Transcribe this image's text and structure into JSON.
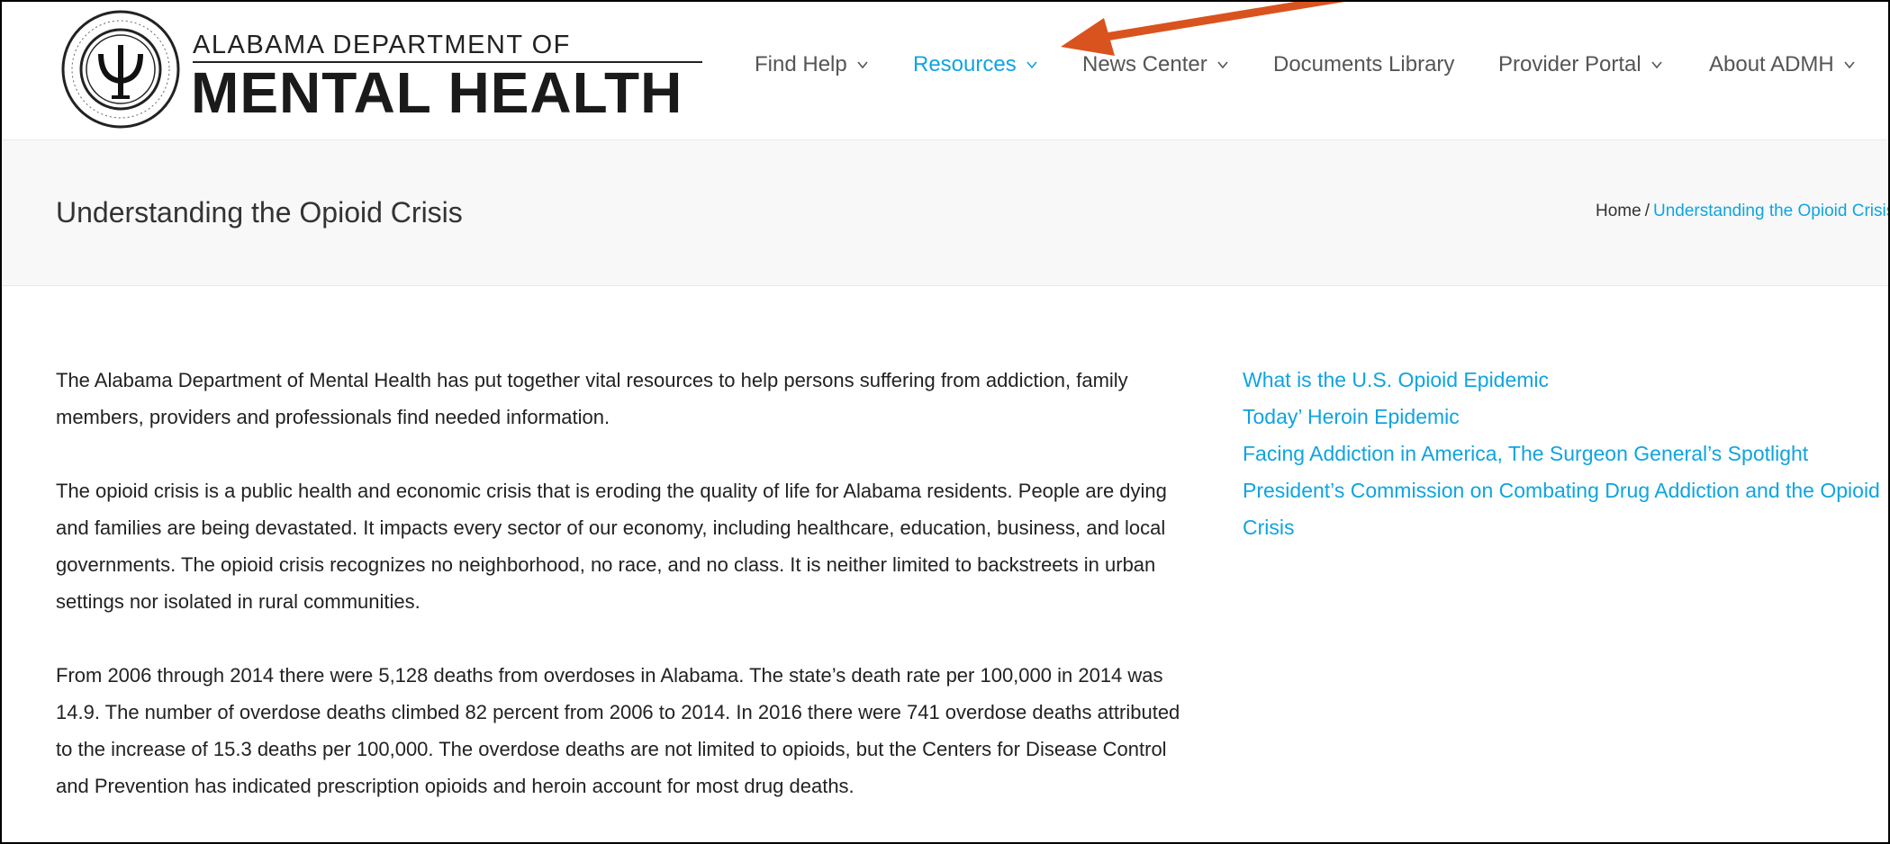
{
  "logo": {
    "line1": "ALABAMA DEPARTMENT OF",
    "line2": "MENTAL HEALTH",
    "seal_top": "ALABAMA",
    "seal_bottom": "DEPARTMENT OF MENTAL HEALTH"
  },
  "nav": {
    "items": [
      {
        "label": "Find Help",
        "dropdown": true
      },
      {
        "label": "Resources",
        "dropdown": true,
        "active": true
      },
      {
        "label": "News Center",
        "dropdown": true
      },
      {
        "label": "Documents Library",
        "dropdown": false
      },
      {
        "label": "Provider Portal",
        "dropdown": true
      },
      {
        "label": "About ADMH",
        "dropdown": true
      }
    ]
  },
  "page": {
    "title": "Understanding the Opioid Crisis",
    "breadcrumb_home": "Home",
    "breadcrumb_sep": "/",
    "breadcrumb_current": "Understanding the Opioid Crisis"
  },
  "content": {
    "paragraphs": [
      "The Alabama Department of Mental Health has put together vital resources to help persons suffering from addiction, family members, providers and professionals find needed information.",
      "The opioid crisis is a public health and economic crisis that is eroding the quality of life for Alabama residents. People are dying and families are being devastated. It impacts every sector of our economy, including healthcare, education, business, and local governments. The opioid crisis recognizes no neighborhood, no race, and no class. It is neither limited to backstreets in urban settings nor isolated in rural communities.",
      "From 2006 through 2014 there were 5,128 deaths from overdoses in Alabama. The state’s death rate per 100,000 in 2014 was 14.9. The number of overdose deaths climbed 82 percent from 2006 to 2014. In 2016 there were 741 overdose deaths attributed to the increase of 15.3 deaths per 100,000. The overdose deaths are not limited to opioids, but the Centers for Disease Control and Prevention has indicated prescription opioids and heroin account for most drug deaths."
    ]
  },
  "sidebar": {
    "links": [
      "What is the U.S. Opioid Epidemic",
      "Today’ Heroin Epidemic",
      "Facing Addiction in America, The Surgeon General’s Spotlight",
      "President’s Commission on Combating Drug Addiction and the Opioid Crisis"
    ]
  },
  "colors": {
    "accent": "#0fa4e0",
    "annotation_arrow": "#d9531e"
  }
}
